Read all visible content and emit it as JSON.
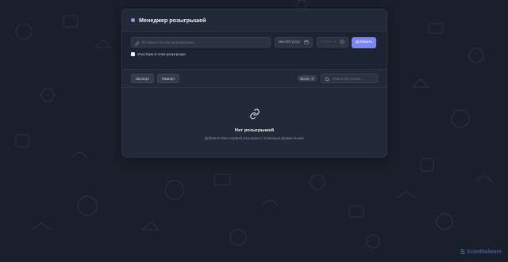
{
  "app": {
    "title": "Менеджер розыгрышей"
  },
  "form": {
    "url_placeholder": "Вставьте ссылку на розыгрыш...",
    "date_placeholder": "mm/dd/yyyy",
    "time_placeholder": "--:-- -",
    "add_label": "Добавить",
    "participate_label": "Участвую в этом розыгрыше",
    "participate_checked": false
  },
  "toolbar": {
    "export_label": "Экспорт",
    "import_label": "Импорт",
    "total_label": "Всего:",
    "total_count": "0",
    "search_placeholder": "Поиск по ссылке..."
  },
  "empty_state": {
    "title": "Нет розыгрышей",
    "subtitle": "Добавьте ваш первый розыгрыш с помощью формы выше"
  },
  "watermark": {
    "text": "ScanMalware",
    "logo": "S"
  },
  "colors": {
    "background": "#1a202b",
    "card": "#222a38",
    "accent": "#7d86ee",
    "header_dot": "#8e96f3"
  },
  "icons": {
    "url": "link-icon",
    "date": "calendar-icon",
    "time": "clock-icon",
    "search": "search-icon",
    "empty": "link-icon"
  }
}
